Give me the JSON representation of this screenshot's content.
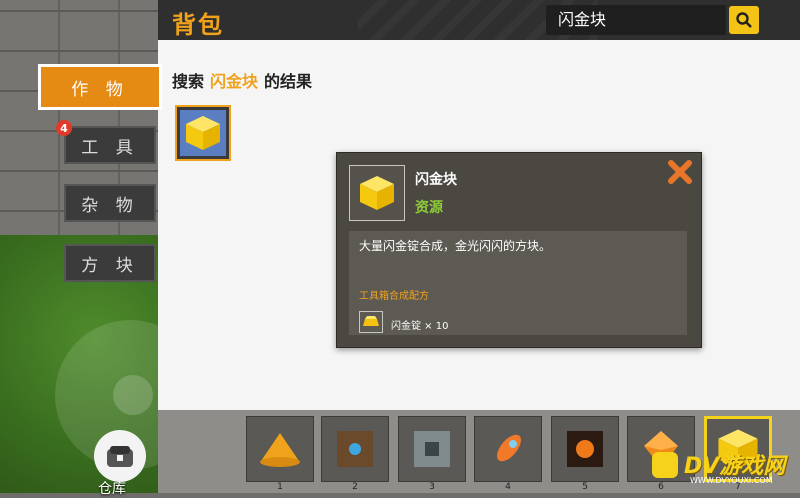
{
  "panel": {
    "title": "背包",
    "search_value": "闪金块",
    "result_prefix": "搜索",
    "result_keyword": "闪金块",
    "result_suffix": "的结果"
  },
  "tabs": [
    {
      "label": "作 物",
      "active": true
    },
    {
      "label": "工 具",
      "badge": "4"
    },
    {
      "label": "杂 物"
    },
    {
      "label": "方 块"
    }
  ],
  "detail": {
    "name": "闪金块",
    "type": "资源",
    "description": "大量闪金锭合成，金光闪闪的方块。",
    "recipe_title": "工具箱合成配方",
    "ingredient": "闪金锭 × 10"
  },
  "hotbar": {
    "slots": [
      {
        "num": "1",
        "icon": "gold-pile-icon"
      },
      {
        "num": "2",
        "icon": "blue-core-block-icon"
      },
      {
        "num": "3",
        "icon": "machine-block-icon"
      },
      {
        "num": "4",
        "icon": "rocket-icon"
      },
      {
        "num": "5",
        "icon": "magma-block-icon"
      },
      {
        "num": "6",
        "icon": "orange-gem-icon"
      },
      {
        "num": "7",
        "icon": "gold-block-icon",
        "selected": true
      }
    ]
  },
  "storage": {
    "label": "仓库"
  },
  "watermark": {
    "text": "DV游戏网",
    "sub": "WWW.DVYOUXI.COM"
  },
  "colors": {
    "accent": "#f0a21c",
    "resource_green": "#8ecb3a",
    "select_yellow": "#f3d41a"
  }
}
